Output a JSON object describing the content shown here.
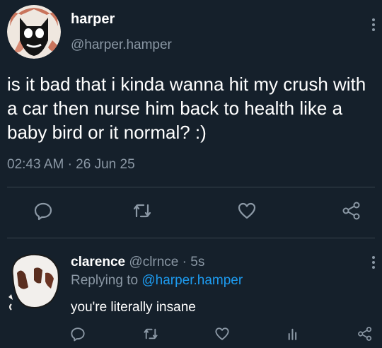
{
  "colors": {
    "background": "#15202b",
    "text": "#e7e9ea",
    "muted": "#8b98a5",
    "link": "#1d9bf0",
    "divider": "#38444d"
  },
  "main_tweet": {
    "display_name": "harper",
    "handle": "@harper.hamper",
    "text": "is it bad that i kinda wanna hit my crush with a car then nurse him back to health like a baby bird or it normal? :)",
    "time": "02:43 AM",
    "separator": "·",
    "date": "26 Jun 25",
    "actions": [
      "reply-icon",
      "retweet-icon",
      "like-icon",
      "share-icon"
    ]
  },
  "reply_tweet": {
    "display_name": "clarence",
    "handle": "@clrnce",
    "separator": "·",
    "age": "5s",
    "replying_label": "Replying to",
    "replying_handle": "@harper.hamper",
    "text": "you're literally insane",
    "actions": [
      "reply-icon",
      "retweet-icon",
      "like-icon",
      "analytics-icon",
      "share-icon"
    ]
  }
}
